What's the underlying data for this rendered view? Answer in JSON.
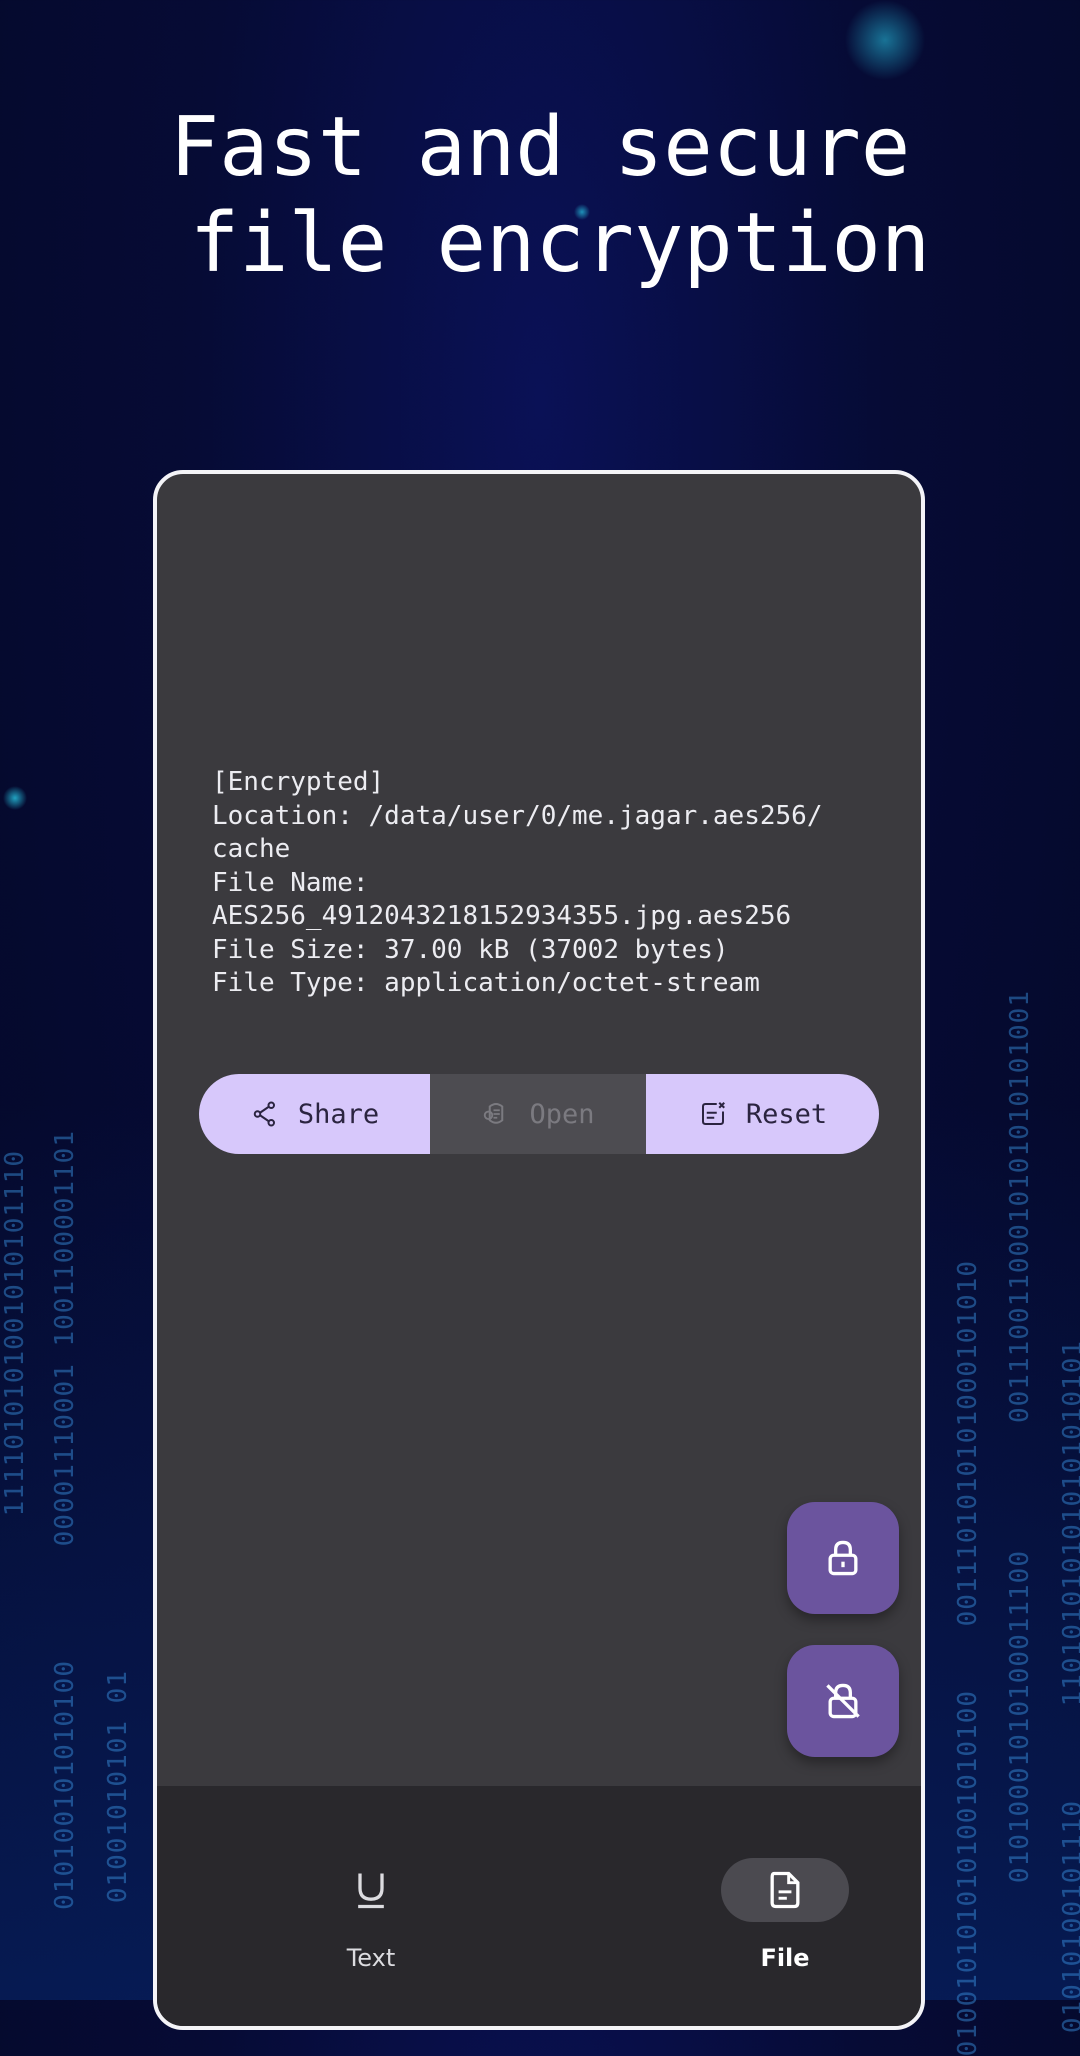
{
  "headline": {
    "line1": "Fast and secure",
    "line2": "file encryption"
  },
  "background": {
    "binary_columns": [
      "1111010101001010101110",
      "00001110001 1001100001101",
      "010100101010100",
      "01001010101 01",
      "0011101010101000101010",
      "0100101010101001010100",
      "01010001010100011100",
      "00111001100010101010101001",
      "1101010101010101010101",
      "01010100101110"
    ]
  },
  "file_info": {
    "text": "[Encrypted]\nLocation: /data/user/0/me.jagar.aes256/\ncache\nFile Name:\nAES256_4912043218152934355.jpg.aes256\nFile Size: 37.00 kB (37002 bytes)\nFile Type: application/octet-stream"
  },
  "actions": {
    "share_label": "Share",
    "open_label": "Open",
    "reset_label": "Reset"
  },
  "fabs": {
    "encrypt_icon": "lock-icon",
    "decrypt_icon": "lock-off-icon"
  },
  "nav": {
    "text_label": "Text",
    "file_label": "File",
    "selected": "File"
  },
  "colors": {
    "accent": "#d7c8fb",
    "fab": "#6b549e",
    "surface": "#3b3a3e",
    "nav_bg": "#29282c"
  }
}
